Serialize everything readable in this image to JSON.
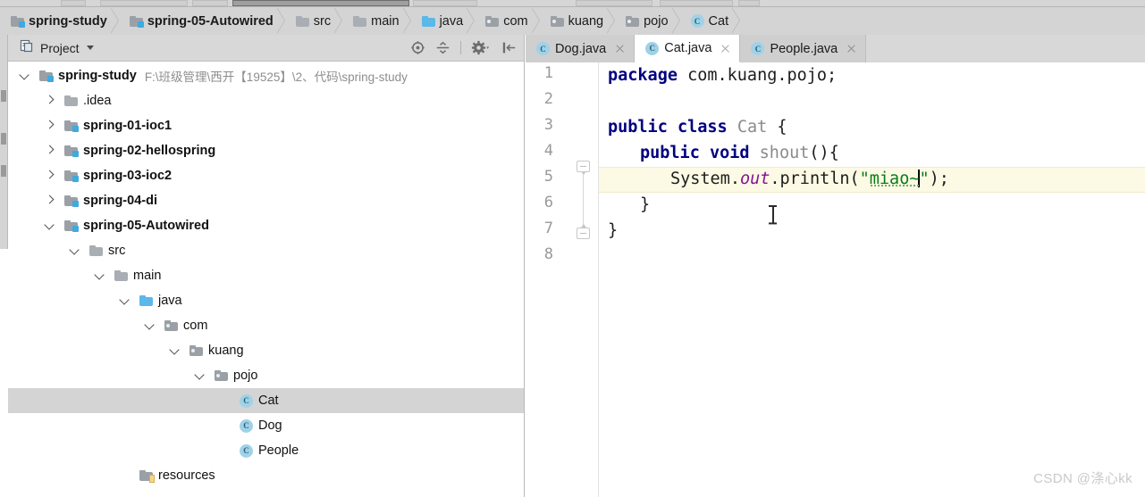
{
  "breadcrumb": {
    "items": [
      {
        "label": "spring-study",
        "icon": "module-folder-icon",
        "bold": true
      },
      {
        "label": "spring-05-Autowired",
        "icon": "module-folder-icon",
        "bold": true
      },
      {
        "label": "src",
        "icon": "folder-icon",
        "bold": false
      },
      {
        "label": "main",
        "icon": "folder-icon",
        "bold": false
      },
      {
        "label": "java",
        "icon": "source-folder-icon",
        "bold": false
      },
      {
        "label": "com",
        "icon": "package-folder-icon",
        "bold": false
      },
      {
        "label": "kuang",
        "icon": "package-folder-icon",
        "bold": false
      },
      {
        "label": "pojo",
        "icon": "package-folder-icon",
        "bold": false
      },
      {
        "label": "Cat",
        "icon": "java-class-icon",
        "bold": false
      }
    ]
  },
  "project_panel": {
    "title": "Project",
    "toolbar": [
      {
        "name": "locate-in-tree-icon",
        "tooltip": "Select Opened File"
      },
      {
        "name": "collapse-all-icon",
        "tooltip": "Collapse All"
      },
      {
        "name": "settings-gear-icon",
        "tooltip": "Settings"
      },
      {
        "name": "hide-panel-icon",
        "tooltip": "Hide"
      }
    ],
    "tree": [
      {
        "label": "spring-study",
        "path": "F:\\班级管理\\西开【19525】\\2、代码\\spring-study",
        "indent": 0,
        "arrow": "down",
        "icon": "module-folder-icon",
        "bold": true,
        "selected": false
      },
      {
        "label": ".idea",
        "path": "",
        "indent": 1,
        "arrow": "right",
        "icon": "folder-icon",
        "bold": false,
        "selected": false
      },
      {
        "label": "spring-01-ioc1",
        "path": "",
        "indent": 1,
        "arrow": "right",
        "icon": "module-folder-icon",
        "bold": true,
        "selected": false
      },
      {
        "label": "spring-02-hellospring",
        "path": "",
        "indent": 1,
        "arrow": "right",
        "icon": "module-folder-icon",
        "bold": true,
        "selected": false
      },
      {
        "label": "spring-03-ioc2",
        "path": "",
        "indent": 1,
        "arrow": "right",
        "icon": "module-folder-icon",
        "bold": true,
        "selected": false
      },
      {
        "label": "spring-04-di",
        "path": "",
        "indent": 1,
        "arrow": "right",
        "icon": "module-folder-icon",
        "bold": true,
        "selected": false
      },
      {
        "label": "spring-05-Autowired",
        "path": "",
        "indent": 1,
        "arrow": "down",
        "icon": "module-folder-icon",
        "bold": true,
        "selected": false
      },
      {
        "label": "src",
        "path": "",
        "indent": 2,
        "arrow": "down",
        "icon": "folder-icon",
        "bold": false,
        "selected": false
      },
      {
        "label": "main",
        "path": "",
        "indent": 3,
        "arrow": "down",
        "icon": "folder-icon",
        "bold": false,
        "selected": false
      },
      {
        "label": "java",
        "path": "",
        "indent": 4,
        "arrow": "down",
        "icon": "source-folder-icon",
        "bold": false,
        "selected": false
      },
      {
        "label": "com",
        "path": "",
        "indent": 5,
        "arrow": "down",
        "icon": "package-folder-icon",
        "bold": false,
        "selected": false
      },
      {
        "label": "kuang",
        "path": "",
        "indent": 6,
        "arrow": "down",
        "icon": "package-folder-icon",
        "bold": false,
        "selected": false
      },
      {
        "label": "pojo",
        "path": "",
        "indent": 7,
        "arrow": "down",
        "icon": "package-folder-icon",
        "bold": false,
        "selected": false
      },
      {
        "label": "Cat",
        "path": "",
        "indent": 8,
        "arrow": "none",
        "icon": "java-class-icon",
        "bold": false,
        "selected": true
      },
      {
        "label": "Dog",
        "path": "",
        "indent": 8,
        "arrow": "none",
        "icon": "java-class-icon",
        "bold": false,
        "selected": false
      },
      {
        "label": "People",
        "path": "",
        "indent": 8,
        "arrow": "none",
        "icon": "java-class-icon",
        "bold": false,
        "selected": false
      },
      {
        "label": "resources",
        "path": "",
        "indent": 4,
        "arrow": "none",
        "icon": "resources-folder-icon",
        "bold": false,
        "selected": false
      }
    ]
  },
  "editor": {
    "tabs": [
      {
        "label": "Dog.java",
        "icon": "java-class-icon",
        "active": false
      },
      {
        "label": "Cat.java",
        "icon": "java-class-icon",
        "active": true
      },
      {
        "label": "People.java",
        "icon": "java-class-icon",
        "active": false
      }
    ],
    "line_numbers": [
      "1",
      "2",
      "3",
      "4",
      "5",
      "6",
      "7",
      "8"
    ],
    "highlighted_line": 5,
    "code": {
      "l1_kw": "package",
      "l1_rest": " com.kuang.pojo;",
      "l3_kw1": "public",
      "l3_kw2": "class",
      "l3_name": "Cat",
      "l3_brace": "{",
      "l4_kw1": "public",
      "l4_kw2": "void",
      "l4_name": "shout",
      "l4_rest": "(){",
      "l5_sys": "System.",
      "l5_out": "out",
      "l5_println": ".println(",
      "l5_quote_open": "\"",
      "l5_string": "miao~",
      "l5_quote_close": "\"",
      "l5_tail": ");",
      "l6_brace": "}",
      "l7_brace": "}"
    },
    "colors": {
      "keyword": "#000080",
      "string": "#067d17",
      "field": "#871094",
      "identifier": "#8b8b8b",
      "highlight_line": "#fcf9e4",
      "selection": "#d4d4d4"
    }
  },
  "watermark": "CSDN @涤心kk"
}
